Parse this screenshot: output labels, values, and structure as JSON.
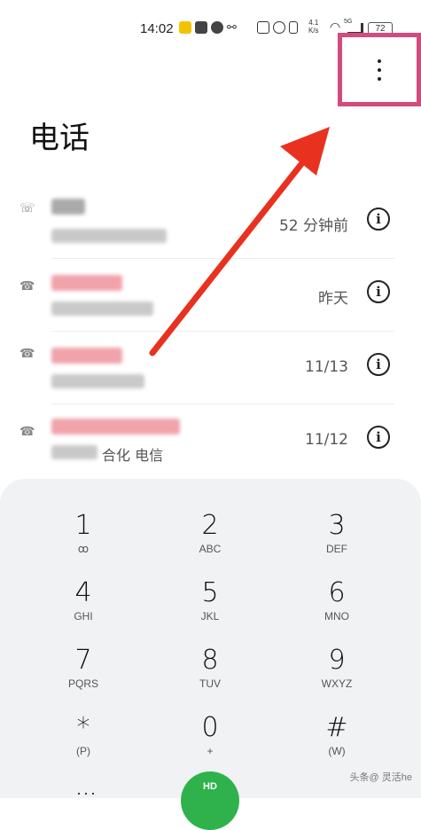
{
  "status": {
    "time": "14:02",
    "speed_top": "4.1",
    "speed_bottom": "K/s",
    "signal_label": "5G",
    "battery": "72"
  },
  "header": {
    "title": "电话",
    "menu_icon": "more-vertical-icon"
  },
  "calls": [
    {
      "type_icon": "incoming-call-icon",
      "time": "52 分钟前"
    },
    {
      "type_icon": "outgoing-call-icon",
      "time": "昨天"
    },
    {
      "type_icon": "missed-call-icon",
      "time": "11/13"
    },
    {
      "type_icon": "outgoing-call-icon",
      "time": "11/12",
      "suffix": "合化 电信"
    }
  ],
  "keypad": [
    {
      "digit": "1",
      "letters": "ꝏ"
    },
    {
      "digit": "2",
      "letters": "ABC"
    },
    {
      "digit": "3",
      "letters": "DEF"
    },
    {
      "digit": "4",
      "letters": "GHI"
    },
    {
      "digit": "5",
      "letters": "JKL"
    },
    {
      "digit": "6",
      "letters": "MNO"
    },
    {
      "digit": "7",
      "letters": "PQRS"
    },
    {
      "digit": "8",
      "letters": "TUV"
    },
    {
      "digit": "9",
      "letters": "WXYZ"
    },
    {
      "digit": "*",
      "letters": "(P)"
    },
    {
      "digit": "0",
      "letters": "+"
    },
    {
      "digit": "#",
      "letters": "(W)"
    }
  ],
  "call_button": {
    "label": "HD"
  },
  "watermark": "头条@ 灵活he",
  "colors": {
    "highlight_box": "#d34b7c",
    "arrow": "#e8321f",
    "call_green": "#2fb24c"
  }
}
